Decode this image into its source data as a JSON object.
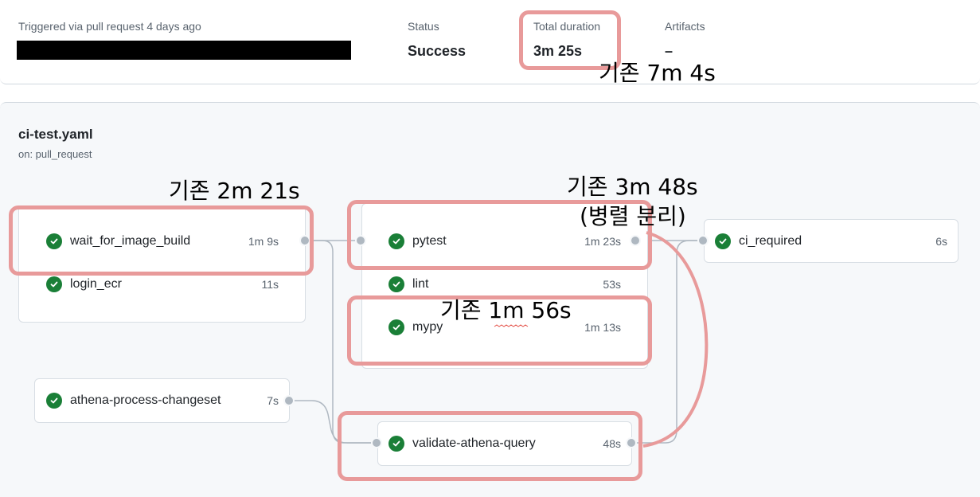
{
  "summary": {
    "trigger": "Triggered via pull request 4 days ago",
    "status_label": "Status",
    "status_value": "Success",
    "duration_label": "Total duration",
    "duration_value": "3m 25s",
    "artifacts_label": "Artifacts",
    "artifacts_value": "–"
  },
  "workflow": {
    "file": "ci-test.yaml",
    "trigger": "on: pull_request"
  },
  "jobs": {
    "wait_for_image_build": {
      "name": "wait_for_image_build",
      "duration": "1m 9s",
      "status": "success"
    },
    "login_ecr": {
      "name": "login_ecr",
      "duration": "11s",
      "status": "success"
    },
    "athena_process_changeset": {
      "name": "athena-process-changeset",
      "duration": "7s",
      "status": "success"
    },
    "pytest": {
      "name": "pytest",
      "duration": "1m 23s",
      "status": "success"
    },
    "lint": {
      "name": "lint",
      "duration": "53s",
      "status": "success"
    },
    "mypy": {
      "name": "mypy",
      "duration": "1m 13s",
      "status": "success"
    },
    "validate_athena_query": {
      "name": "validate-athena-query",
      "duration": "48s",
      "status": "success"
    },
    "ci_required": {
      "name": "ci_required",
      "duration": "6s",
      "status": "success"
    }
  },
  "annotations": {
    "total_before": "기존 7m 4s",
    "wait_before": "기존 2m 21s",
    "pytest_before": "기존 3m 48s",
    "pytest_note": "(병렬 분리)",
    "mypy_before": "기존 1m 56s"
  },
  "colors": {
    "success": "#1a7f37",
    "highlight": "#e89a9a"
  }
}
